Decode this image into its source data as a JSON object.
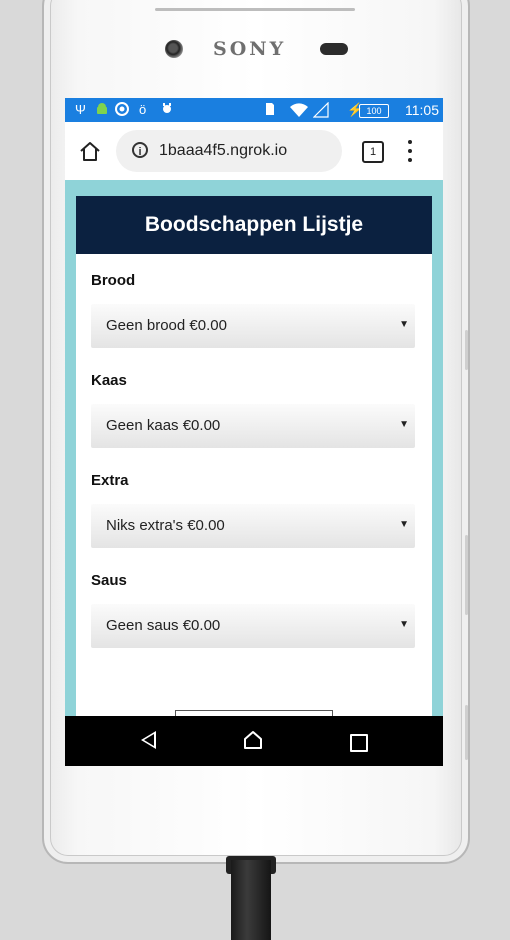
{
  "device": {
    "brand": "SONY"
  },
  "statusbar": {
    "time": "11:05",
    "battery": "100",
    "icons": [
      "usb-icon",
      "android-icon",
      "firefox-icon",
      "alarm-icon",
      "notification-icon",
      "sim-icon",
      "wifi-icon",
      "signal-icon",
      "charging-icon"
    ],
    "color": "#1a7fe0"
  },
  "browser": {
    "url": "1baaa4f5.ngrok.io",
    "tab_count": "1",
    "info_symbol": "i"
  },
  "page": {
    "title": "Boodschappen Lijstje",
    "background_color": "#8fd3d8",
    "header_color": "#0b2140",
    "groups": [
      {
        "label": "Brood",
        "selected": "Geen brood €0.00"
      },
      {
        "label": "Kaas",
        "selected": "Geen kaas €0.00"
      },
      {
        "label": "Extra",
        "selected": "Niks extra's €0.00"
      },
      {
        "label": "Saus",
        "selected": "Geen saus €0.00"
      }
    ],
    "caret": "▼"
  }
}
